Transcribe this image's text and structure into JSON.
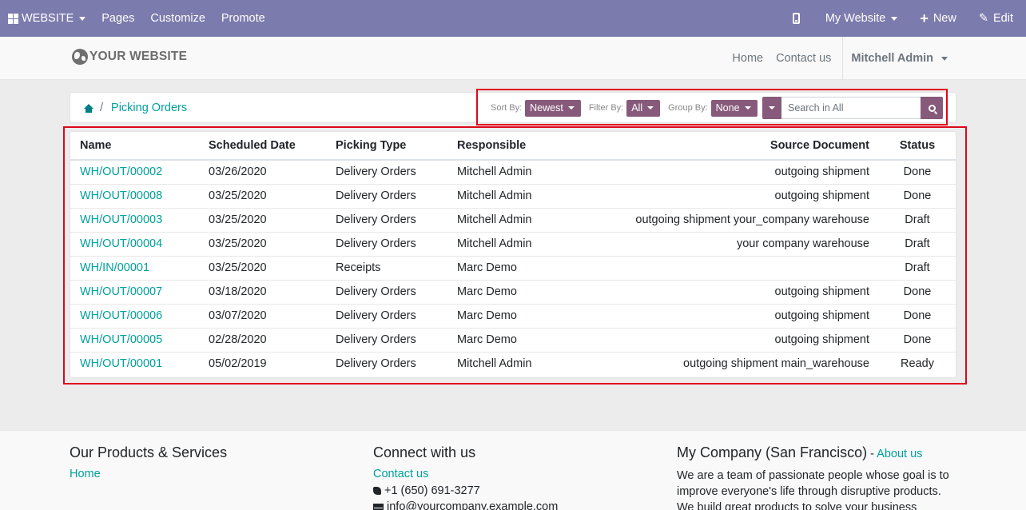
{
  "topbar": {
    "website_label": "WEBSITE",
    "pages_label": "Pages",
    "customize_label": "Customize",
    "promote_label": "Promote",
    "my_website_label": "My Website",
    "new_label": "New",
    "edit_label": "Edit",
    "bg_color": "#7c7bad"
  },
  "header": {
    "logo_text": "YOUR WEBSITE",
    "nav": [
      "Home",
      "Contact us"
    ],
    "user_name": "Mitchell Admin"
  },
  "breadcrumb": {
    "current": "Picking Orders",
    "separator": "/"
  },
  "controls": {
    "sort_label": "Sort By:",
    "sort_value": "Newest",
    "filter_label": "Filter By:",
    "filter_value": "All",
    "group_label": "Group By:",
    "group_value": "None",
    "search_placeholder": "Search in All",
    "accent_color": "#875a7b"
  },
  "table": {
    "columns": [
      "Name",
      "Scheduled Date",
      "Picking Type",
      "Responsible",
      "Source Document",
      "Status"
    ],
    "rows": [
      {
        "name": "WH/OUT/00002",
        "date": "03/26/2020",
        "type": "Delivery Orders",
        "responsible": "Mitchell Admin",
        "source": "outgoing shipment",
        "status": "Done"
      },
      {
        "name": "WH/OUT/00008",
        "date": "03/25/2020",
        "type": "Delivery Orders",
        "responsible": "Mitchell Admin",
        "source": "outgoing shipment",
        "status": "Done"
      },
      {
        "name": "WH/OUT/00003",
        "date": "03/25/2020",
        "type": "Delivery Orders",
        "responsible": "Mitchell Admin",
        "source": "outgoing shipment your_company warehouse",
        "status": "Draft"
      },
      {
        "name": "WH/OUT/00004",
        "date": "03/25/2020",
        "type": "Delivery Orders",
        "responsible": "Mitchell Admin",
        "source": "your company warehouse",
        "status": "Draft"
      },
      {
        "name": "WH/IN/00001",
        "date": "03/25/2020",
        "type": "Receipts",
        "responsible": "Marc Demo",
        "source": "",
        "status": "Draft"
      },
      {
        "name": "WH/OUT/00007",
        "date": "03/18/2020",
        "type": "Delivery Orders",
        "responsible": "Marc Demo",
        "source": "outgoing shipment",
        "status": "Done"
      },
      {
        "name": "WH/OUT/00006",
        "date": "03/07/2020",
        "type": "Delivery Orders",
        "responsible": "Marc Demo",
        "source": "outgoing shipment",
        "status": "Done"
      },
      {
        "name": "WH/OUT/00005",
        "date": "02/28/2020",
        "type": "Delivery Orders",
        "responsible": "Marc Demo",
        "source": "outgoing shipment",
        "status": "Done"
      },
      {
        "name": "WH/OUT/00001",
        "date": "05/02/2019",
        "type": "Delivery Orders",
        "responsible": "Mitchell Admin",
        "source": "outgoing shipment main_warehouse",
        "status": "Ready"
      }
    ],
    "link_color": "#00a09d"
  },
  "footer": {
    "col1_title": "Our Products & Services",
    "col1_link": "Home",
    "col2_title": "Connect with us",
    "col2_link": "Contact us",
    "phone": "+1 (650) 691-3277",
    "email": "info@yourcompany.example.com",
    "col3_title": "My Company (San Francisco)",
    "col3_title_sep": " - ",
    "col3_link": "About us",
    "col3_text": "We are a team of passionate people whose goal is to improve everyone's life through disruptive products. We build great products to solve your business problems."
  },
  "highlight_color": "#e0061b"
}
